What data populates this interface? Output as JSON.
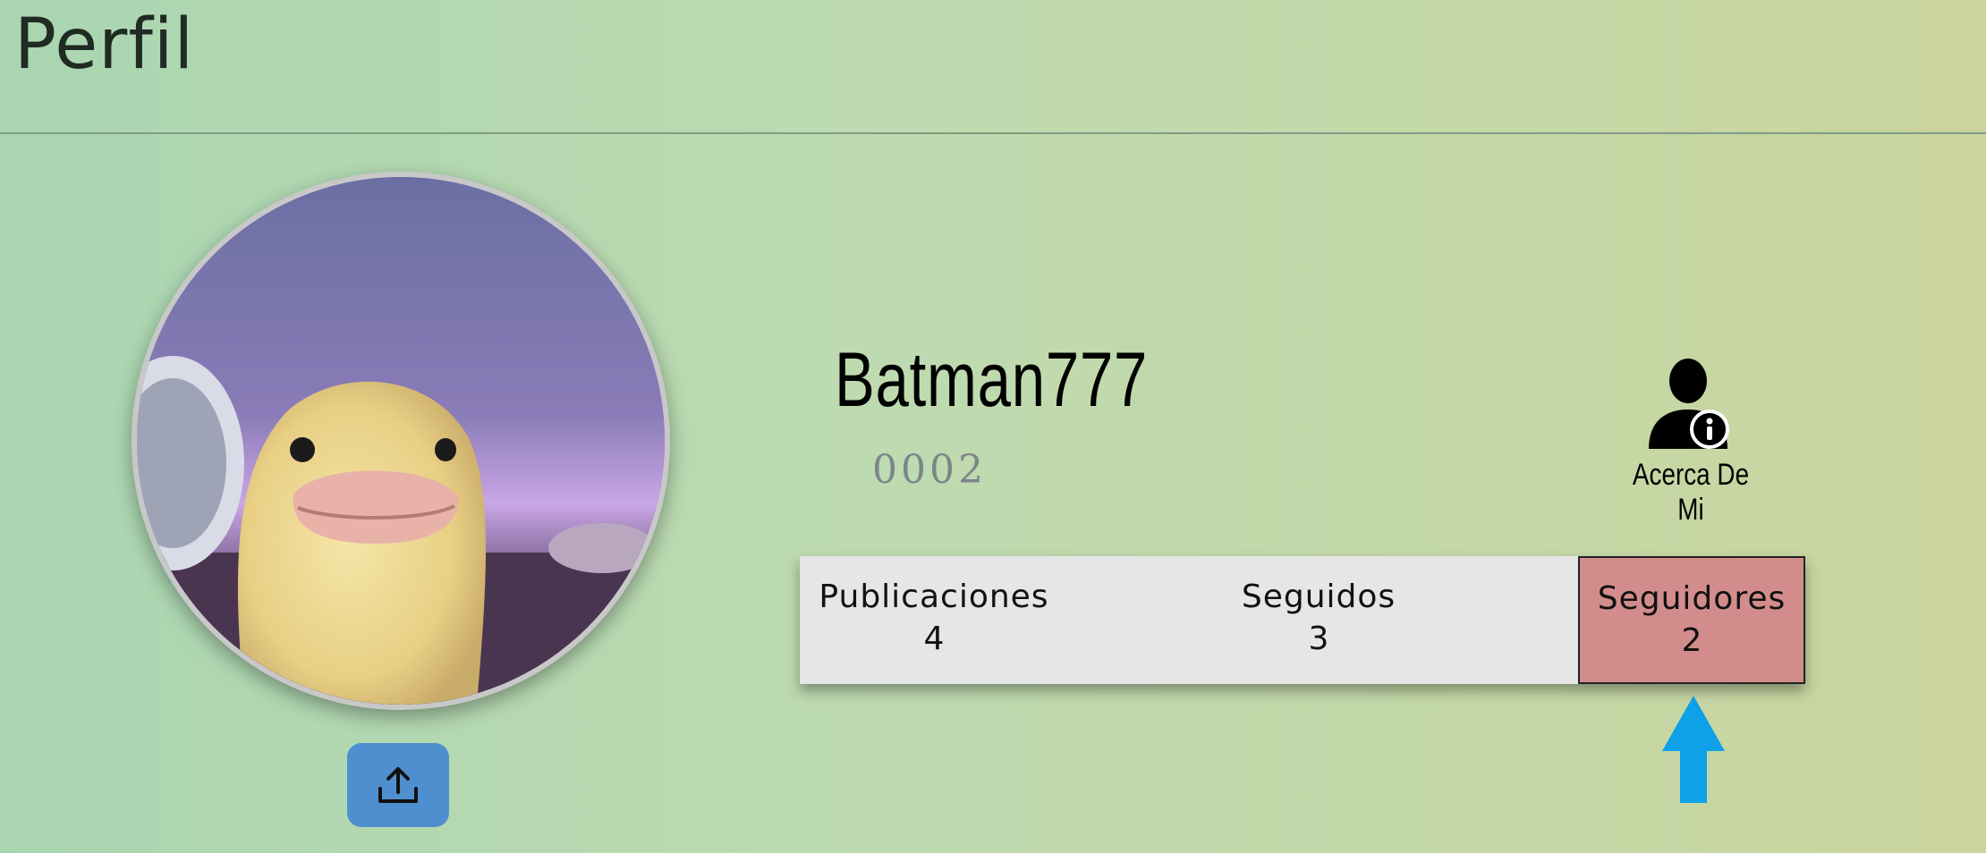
{
  "header": {
    "title": "Perfil"
  },
  "profile": {
    "username": "Batman777",
    "user_code": "0002",
    "avatar_icon": "duckling-photo",
    "upload_icon": "upload-icon"
  },
  "about_me": {
    "label": "Acerca De Mi",
    "icon": "user-info-icon"
  },
  "stats": [
    {
      "label": "Publicaciones",
      "value": "4"
    },
    {
      "label": "Seguidos",
      "value": "3"
    },
    {
      "label": "Seguidores",
      "value": "2",
      "highlighted": true
    }
  ],
  "colors": {
    "upload_button": "#4f8fd0",
    "highlight_stat": "#d38c8c",
    "arrow": "#0ea0e8",
    "stats_bar": "#e5e6e6"
  }
}
